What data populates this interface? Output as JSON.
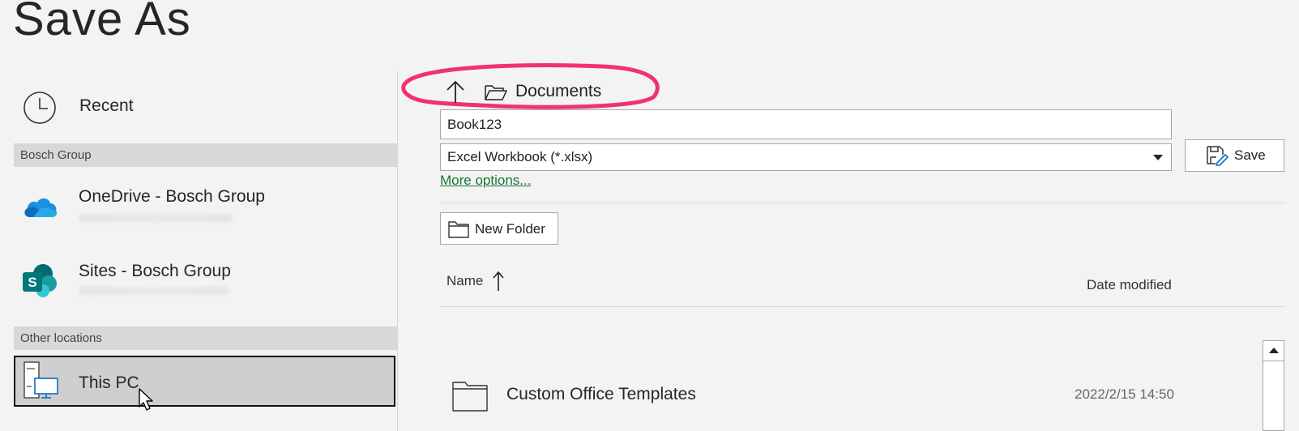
{
  "page": {
    "title": "Save As"
  },
  "sidebar": {
    "recent_label": "Recent",
    "sections": [
      {
        "header": "Bosch Group"
      },
      {
        "header": "Other locations"
      }
    ],
    "items": [
      {
        "label": "OneDrive - Bosch Group",
        "icon": "onedrive-cloud-icon"
      },
      {
        "label": "Sites - Bosch Group",
        "icon": "sharepoint-icon"
      },
      {
        "label": "This PC",
        "icon": "this-pc-icon",
        "selected": true
      }
    ]
  },
  "location": {
    "current_folder": "Documents",
    "up_icon": "arrow-up-icon",
    "folder_icon": "open-folder-icon"
  },
  "form": {
    "filename_value": "Book123",
    "filetype_value": "Excel Workbook (*.xlsx)",
    "save_label": "Save",
    "more_options_label": "More options...",
    "new_folder_label": "New Folder"
  },
  "file_list": {
    "columns": {
      "name": "Name",
      "date": "Date modified"
    },
    "sort_icon": "sort-ascending-arrow-icon",
    "rows": [
      {
        "name": "Custom Office Templates",
        "date": "2022/2/15 14:50",
        "icon": "folder-icon"
      }
    ]
  },
  "colors": {
    "annotation_highlight": "#f0336e",
    "link_green": "#1a7335",
    "selected_bg": "#cfcfcf",
    "section_header_bg": "#d8d8d8"
  }
}
